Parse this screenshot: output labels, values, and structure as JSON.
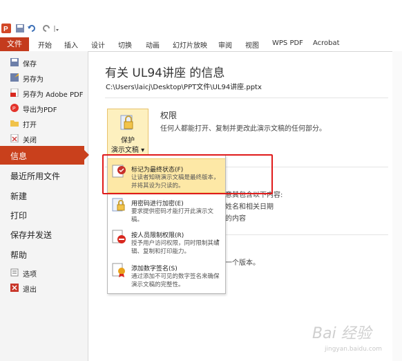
{
  "quick_access": {
    "icons": [
      "powerpoint-icon",
      "save-icon",
      "undo-icon",
      "redo-icon",
      "customize-icon"
    ]
  },
  "ribbon": {
    "file_tab": "文件",
    "tabs": [
      "开始",
      "插入",
      "设计",
      "切换",
      "动画",
      "幻灯片放映",
      "审阅",
      "视图",
      "WPS PDF",
      "Acrobat"
    ]
  },
  "left_pane": {
    "small_items": [
      {
        "label": "保存",
        "icon": "save-icon"
      },
      {
        "label": "另存为",
        "icon": "save-as-icon"
      },
      {
        "label": "另存为 Adobe PDF",
        "icon": "pdf-icon"
      },
      {
        "label": "导出为PDF",
        "icon": "export-pdf-icon"
      },
      {
        "label": "打开",
        "icon": "folder-open-icon"
      },
      {
        "label": "关闭",
        "icon": "close-file-icon"
      }
    ],
    "selected": "信息",
    "sections": [
      "最近所用文件",
      "新建",
      "打印",
      "保存并发送",
      "帮助"
    ],
    "bottom_items": [
      {
        "label": "选项",
        "icon": "options-icon"
      },
      {
        "label": "退出",
        "icon": "exit-icon"
      }
    ]
  },
  "main": {
    "title": "有关 UL94讲座 的信息",
    "path": "C:\\Users\\laicj\\Desktop\\PPT文件\\UL94讲座.pptx",
    "protect_button": {
      "line1": "保护",
      "line2": "演示文稿 ▾"
    },
    "permissions_heading": "权限",
    "permissions_desc": "任何人都能打开、复制并更改此演示文稿的任何部分。",
    "partial_lines": [
      "意其包含以下内容:",
      "姓名和相关日期",
      "的内容",
      "一个版本。"
    ]
  },
  "dropdown": [
    {
      "title": "标记为最终状态(F)",
      "desc": "让读者知晓演示文稿是最终版本，并将其设为只读的。",
      "icon": "mark-final-icon",
      "highlighted": true
    },
    {
      "title": "用密码进行加密(E)",
      "desc": "要求提供密码才能打开此演示文稿。",
      "icon": "encrypt-lock-icon",
      "highlighted": false
    },
    {
      "title": "按人员限制权限(R)",
      "desc": "授予用户访问权限，同时限制其编辑、复制和打印能力。",
      "icon": "restrict-permission-icon",
      "highlighted": false,
      "submenu": "▸"
    },
    {
      "title": "添加数字签名(S)",
      "desc": "通过添加不可见的数字签名来确保演示文稿的完整性。",
      "icon": "digital-signature-icon",
      "highlighted": false
    }
  ],
  "watermark": {
    "text": "Bai 经验",
    "url": "jingyan.baidu.com"
  },
  "colors": {
    "file_tab": "#c43b1d",
    "selected": "#c9401c",
    "highlight": "#fde8a6",
    "annotation": "#e01a1a"
  }
}
